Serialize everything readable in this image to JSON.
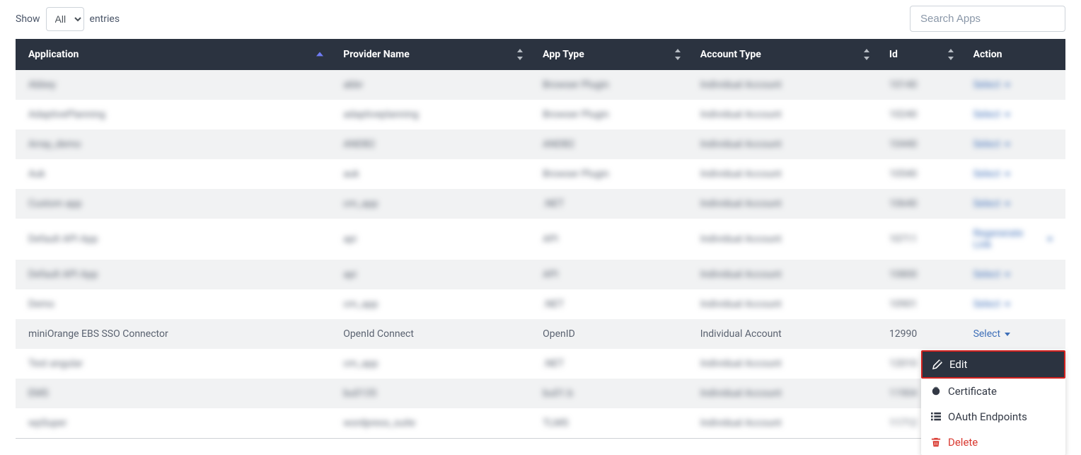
{
  "controls": {
    "show_label": "Show",
    "entries_label": "entries",
    "length_options": [
      "All"
    ],
    "length_selected": "All",
    "search_placeholder": "Search Apps"
  },
  "columns": {
    "application": "Application",
    "provider": "Provider Name",
    "app_type": "App Type",
    "account_type": "Account Type",
    "id": "Id",
    "action": "Action"
  },
  "rows": [
    {
      "app": "Abbey",
      "provider": "abbr",
      "type": "Browser Plugin",
      "account": "Individual Account",
      "id": "10140",
      "action": "Select",
      "blurred": true
    },
    {
      "app": "AdaptivePlanning",
      "provider": "adaptiveplanning",
      "type": "Browser Plugin",
      "account": "Individual Account",
      "id": "10240",
      "action": "Select",
      "blurred": true
    },
    {
      "app": "Array_demo",
      "provider": "ANDB2",
      "type": "ANDB2",
      "account": "Individual Account",
      "id": "10440",
      "action": "Select",
      "blurred": true
    },
    {
      "app": "Auk",
      "provider": "auk",
      "type": "Browser Plugin",
      "account": "Individual Account",
      "id": "10540",
      "action": "Select",
      "blurred": true
    },
    {
      "app": "Custom app",
      "provider": "cm_app",
      "type": ".NET",
      "account": "Individual Account",
      "id": "10640",
      "action": "Select",
      "blurred": true
    },
    {
      "app": "Default API App",
      "provider": "api",
      "type": "API",
      "account": "Individual Account",
      "id": "10711",
      "action": "Regenerate Link",
      "blurred": true
    },
    {
      "app": "Default API App",
      "provider": "api",
      "type": "API",
      "account": "Individual Account",
      "id": "10800",
      "action": "Select",
      "blurred": true
    },
    {
      "app": "Demo",
      "provider": "cm_app",
      "type": ".NET",
      "account": "Individual Account",
      "id": "10901",
      "action": "Select",
      "blurred": true
    },
    {
      "app": "miniOrange EBS SSO Connector",
      "provider": "OpenId Connect",
      "type": "OpenID",
      "account": "Individual Account",
      "id": "12990",
      "action": "Select",
      "blurred": false,
      "menu_open": true
    },
    {
      "app": "Test angular",
      "provider": "cm_app",
      "type": ".NET",
      "account": "Individual Account",
      "id": "12010",
      "action": "Select",
      "blurred": true
    },
    {
      "app": "EMS",
      "provider": "bu0135",
      "type": "bu01.b",
      "account": "Individual Account",
      "id": "11904",
      "action": "Select",
      "blurred": true
    },
    {
      "app": "wpSuper",
      "provider": "wordpress_suite",
      "type": "TLMS",
      "account": "Individual Account",
      "id": "11712",
      "action": "Select",
      "blurred": true
    }
  ],
  "dropdown": {
    "edit": "Edit",
    "certificate": "Certificate",
    "oauth": "OAuth Endpoints",
    "delete": "Delete"
  }
}
